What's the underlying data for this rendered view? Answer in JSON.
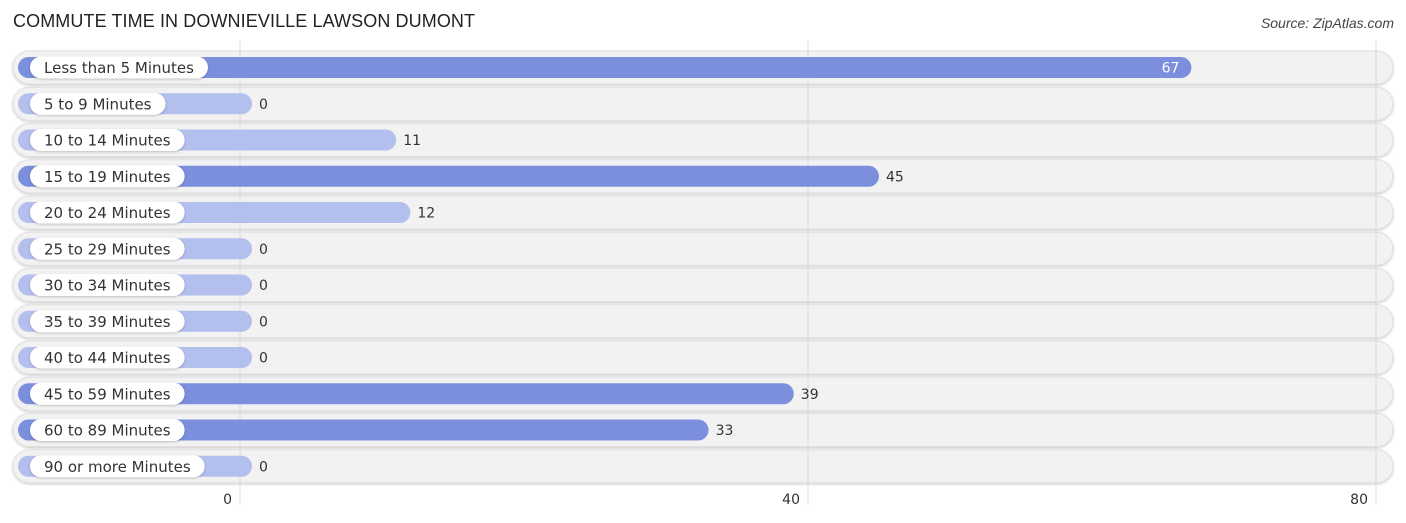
{
  "header": {
    "title": "COMMUTE TIME IN DOWNIEVILLE LAWSON DUMONT",
    "source": "Source: ZipAtlas.com"
  },
  "colors": {
    "bar_strong": "#7b8fdd",
    "bar_light": "#b3bfec",
    "track": "#f2f2f2",
    "grid": "#d9d9d9"
  },
  "chart_data": {
    "type": "bar",
    "orientation": "horizontal",
    "title": "COMMUTE TIME IN DOWNIEVILLE LAWSON DUMONT",
    "xlabel": "",
    "ylabel": "",
    "categories": [
      "Less than 5 Minutes",
      "5 to 9 Minutes",
      "10 to 14 Minutes",
      "15 to 19 Minutes",
      "20 to 24 Minutes",
      "25 to 29 Minutes",
      "30 to 34 Minutes",
      "35 to 39 Minutes",
      "40 to 44 Minutes",
      "45 to 59 Minutes",
      "60 to 89 Minutes",
      "90 or more Minutes"
    ],
    "values": [
      67,
      0,
      11,
      45,
      12,
      0,
      0,
      0,
      0,
      39,
      33,
      0
    ],
    "xlim": [
      0,
      80
    ],
    "xticks": [
      0,
      40,
      80
    ],
    "grid": true,
    "legend": "none"
  }
}
